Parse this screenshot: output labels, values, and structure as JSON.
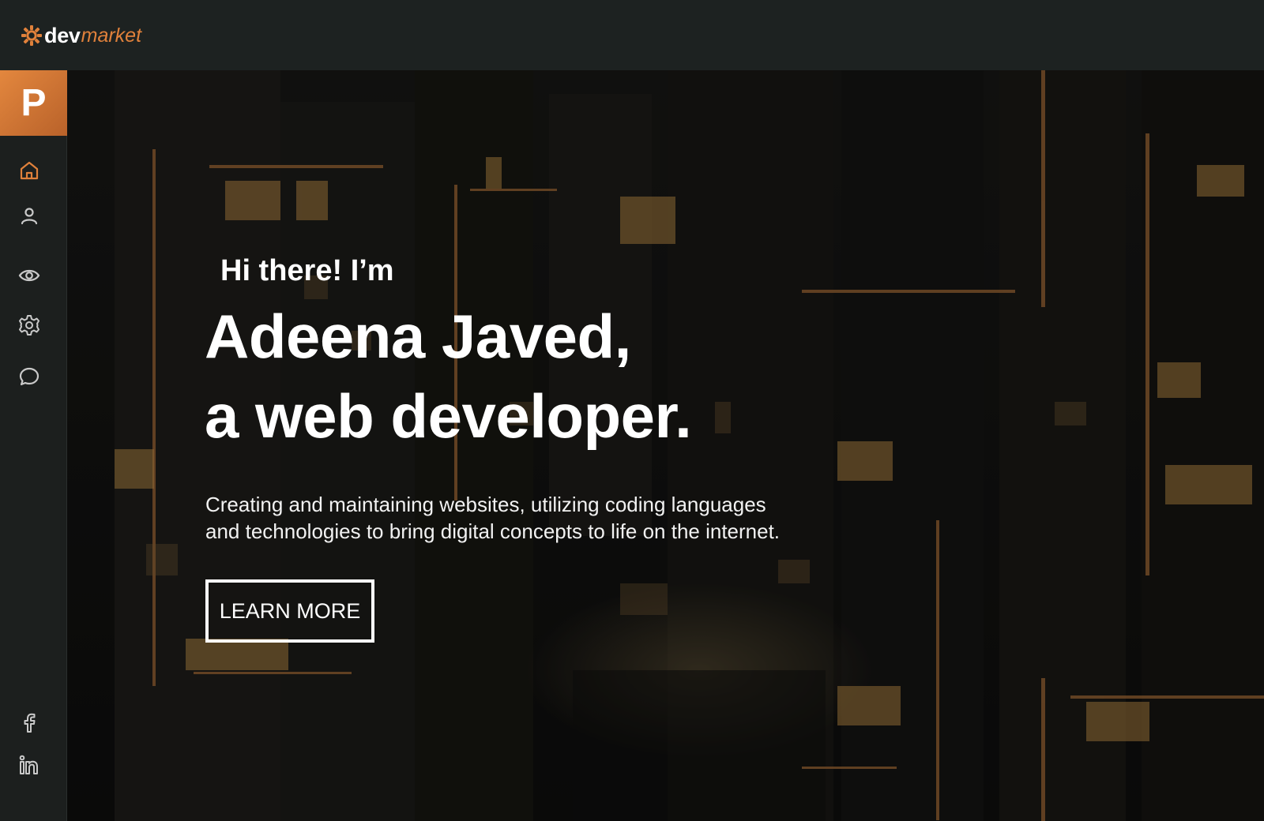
{
  "brand": {
    "logo_icon": "gear-sun-icon",
    "name_bold": "dev",
    "name_italic": "market",
    "accent_color": "#e0813b"
  },
  "sidebar": {
    "avatar_letter": "P",
    "items": [
      {
        "icon": "home-icon",
        "active": true
      },
      {
        "icon": "user-icon"
      },
      {
        "icon": "eye-icon"
      },
      {
        "icon": "gear-icon"
      },
      {
        "icon": "chat-icon"
      }
    ],
    "social": [
      {
        "icon": "facebook-icon"
      },
      {
        "icon": "linkedin-icon"
      }
    ]
  },
  "hero": {
    "greeting": "Hi there! I’m",
    "name": "Adeena Javed,",
    "role": "a web developer.",
    "description_line1": "Creating and maintaining websites, utilizing coding languages",
    "description_line2": "and technologies to bring digital concepts to life on the internet.",
    "cta_label": "LEARN MORE"
  }
}
